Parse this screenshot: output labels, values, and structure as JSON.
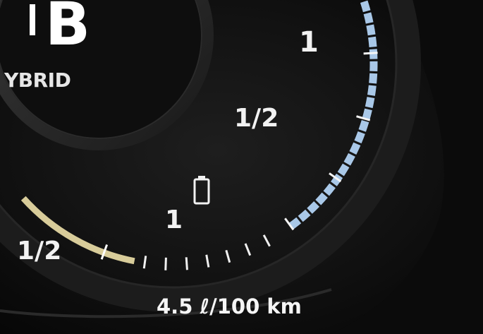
{
  "display": {
    "gear": "B",
    "drive_mode": "YBRID"
  },
  "battery_gauge": {
    "label_full": "1",
    "label_half": "1/2",
    "label_empty": "1",
    "icon": "battery-icon",
    "level_fraction": 0.95,
    "fill_color": "#a9c8e8"
  },
  "fuel_gauge": {
    "label_half": "1/2",
    "fill_color": "#d8cc9a"
  },
  "trip": {
    "consumption": "4.5 ℓ/100 km"
  }
}
